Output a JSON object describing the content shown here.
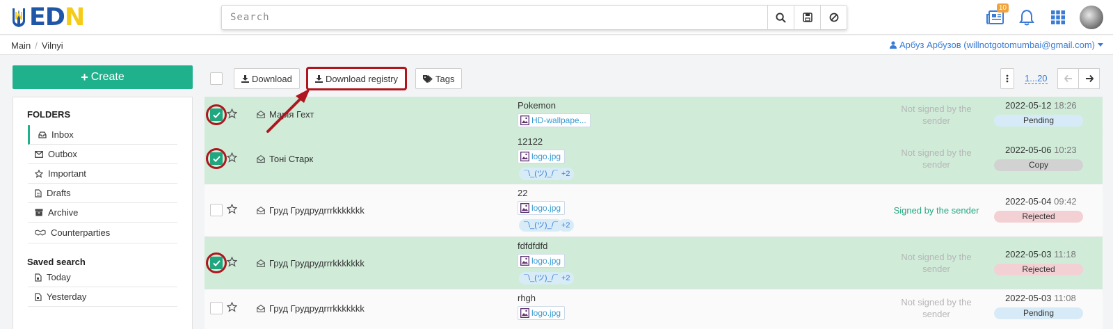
{
  "header": {
    "logo_letters": [
      "E",
      "D",
      "N"
    ],
    "search": {
      "placeholder": "Search"
    },
    "search_buttons": [
      "search-icon",
      "save-icon",
      "clear-icon"
    ],
    "news_badge": "10",
    "icons": [
      "news-icon",
      "bell-icon",
      "apps-grid-icon",
      "avatar"
    ]
  },
  "breadcrumb": {
    "items": [
      "Main",
      "Vilnyi"
    ]
  },
  "user": {
    "label": "Арбуз Арбузов (willnotgotomumbai@gmail.com)"
  },
  "sidebar": {
    "create_label": "Create",
    "folders_title": "FOLDERS",
    "folders": [
      {
        "label": "Inbox",
        "icon": "inbox-icon"
      },
      {
        "label": "Outbox",
        "icon": "envelope-icon"
      },
      {
        "label": "Important",
        "icon": "star-icon"
      },
      {
        "label": "Drafts",
        "icon": "file-icon"
      },
      {
        "label": "Archive",
        "icon": "archive-icon"
      },
      {
        "label": "Counterparties",
        "icon": "handshake-icon"
      }
    ],
    "saved_title": "Saved search",
    "saved": [
      {
        "label": "Today",
        "icon": "file-icon"
      },
      {
        "label": "Yesterday",
        "icon": "file-icon"
      }
    ]
  },
  "toolbar": {
    "download_label": "Download",
    "download_registry_label": "Download registry",
    "tags_label": "Tags",
    "page_range": "1...20"
  },
  "messages": [
    {
      "sender": "Марія Гехт",
      "subject": "Pokemon",
      "attachment": "HD-wallpape...",
      "tag": "",
      "more": "",
      "signature": "Not signed by the sender",
      "date": "2022-05-12",
      "time": "18:26",
      "status": "Pending",
      "selected": true
    },
    {
      "sender": "Тоні Старк",
      "subject": "12122",
      "attachment": "logo.jpg",
      "tag": "¯\\_(ツ)_/¯",
      "more": "+2",
      "signature": "Not signed by the sender",
      "date": "2022-05-06",
      "time": "10:23",
      "status": "Copy",
      "selected": true
    },
    {
      "sender": "Груд Грудрудrrrkkkkkkk",
      "subject": "22",
      "attachment": "logo.jpg",
      "tag": "¯\\_(ツ)_/¯",
      "more": "+2",
      "signature": "Signed by the sender",
      "date": "2022-05-04",
      "time": "09:42",
      "status": "Rejected",
      "selected": false
    },
    {
      "sender": "Груд Грудрудrrrkkkkkkk",
      "subject": "fdfdfdfd",
      "attachment": "logo.jpg",
      "tag": "¯\\_(ツ)_/¯",
      "more": "+2",
      "signature": "Not signed by the sender",
      "date": "2022-05-03",
      "time": "11:18",
      "status": "Rejected",
      "selected": true
    },
    {
      "sender": "Груд Грудрудrrrkkkkkkk",
      "subject": "rhgh",
      "attachment": "logo.jpg",
      "tag": "",
      "more": "",
      "signature": "Not signed by the sender",
      "date": "2022-05-03",
      "time": "11:08",
      "status": "Pending",
      "selected": false
    }
  ],
  "colors": {
    "accent": "#1fb08c",
    "selected_row": "#d0ecd9",
    "highlight": "#b0151e",
    "link": "#3a7bd5",
    "status_pending": "#d6ebf7",
    "status_copy": "#d2d2d2",
    "status_rejected": "#f3d0d3"
  }
}
